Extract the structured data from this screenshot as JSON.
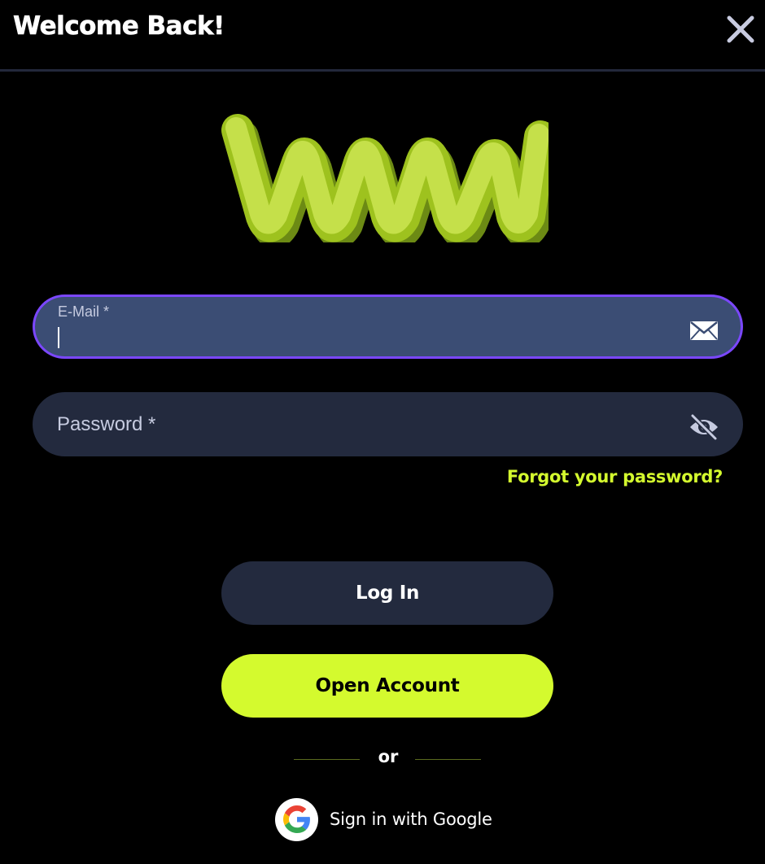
{
  "header": {
    "title": "Welcome Back!",
    "close_icon": "close-icon"
  },
  "logo": {
    "icon": "wave-logo",
    "color": "#c5e04a"
  },
  "form": {
    "email": {
      "label": "E-Mail *",
      "value": "",
      "icon": "envelope-icon",
      "focused": true
    },
    "password": {
      "label": "Password *",
      "value": "",
      "icon": "eye-off-icon"
    },
    "forgot_link": "Forgot your password?"
  },
  "actions": {
    "login_label": "Log In",
    "open_account_label": "Open Account",
    "or_label": "or",
    "google_label": "Sign in with Google",
    "google_icon": "google-icon"
  },
  "colors": {
    "background": "#000000",
    "accent": "#d4fa2e",
    "focus_border": "#7b47ff",
    "field_focused": "#3b4d74",
    "field": "#232a3e"
  }
}
